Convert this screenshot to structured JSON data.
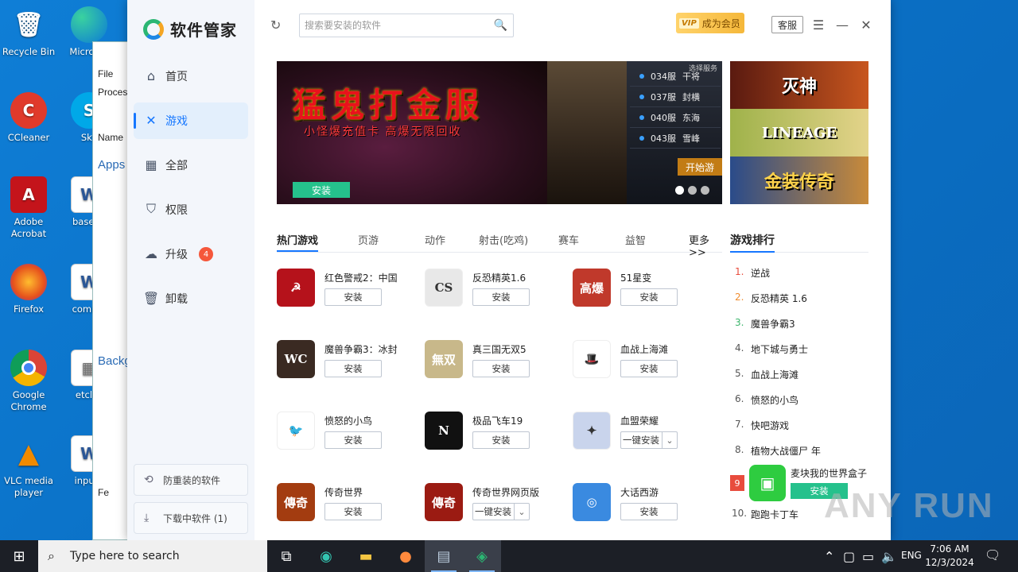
{
  "desktop": {
    "icons_col1": [
      "Recycle Bin",
      "CCleaner",
      "Adobe Acrobat",
      "Firefox",
      "Google Chrome",
      "VLC media player"
    ],
    "icons_col2": [
      "Micro Ed",
      "Sky",
      "basedp",
      "comme",
      "etclos",
      "inputd"
    ]
  },
  "explorer": {
    "menu_file": "File",
    "menu_c": "C",
    "processes": "Process",
    "name_col": "Name",
    "apps": "Apps",
    "backg": "Backg",
    "fe": "Fe"
  },
  "app": {
    "name": "软件管家",
    "search_placeholder": "搜索要安装的软件",
    "vip_badge": "VIP",
    "vip_label": "成为会员",
    "service": "客服",
    "nav": [
      {
        "label": "首页",
        "icon": "home-icon"
      },
      {
        "label": "游戏",
        "icon": "game-icon"
      },
      {
        "label": "全部",
        "icon": "grid-icon"
      },
      {
        "label": "权限",
        "icon": "shield-icon"
      },
      {
        "label": "升级",
        "icon": "upload-cloud-icon",
        "badge": "4"
      },
      {
        "label": "卸载",
        "icon": "trash-icon"
      }
    ],
    "bottom_btns": [
      "防重装的软件",
      "下载中软件  (1)"
    ],
    "banner": {
      "headline": "猛鬼打金服",
      "sub": "小怪爆充值卡  高爆无限回收",
      "servers": [
        [
          "034服",
          "干将"
        ],
        [
          "037服",
          "封横"
        ],
        [
          "040服",
          "东海"
        ],
        [
          "043服",
          "雪峰"
        ]
      ],
      "select_label": "选择服务",
      "start": "开始游",
      "install": "安装"
    },
    "thumbs": [
      "灭神",
      "LINEAGE",
      "金装传奇"
    ],
    "tabs": [
      "热门游戏",
      "页游",
      "动作",
      "射击(吃鸡)",
      "赛车",
      "益智",
      "更多>>"
    ],
    "rank_title": "游戏排行",
    "games": [
      {
        "name": "红色警戒2：中国",
        "btn": "安装",
        "color": "#b5121b",
        "glyph": "☭"
      },
      {
        "name": "反恐精英1.6",
        "btn": "安装",
        "color": "#e8e8e8",
        "glyph": "CS"
      },
      {
        "name": "51星变",
        "btn": "安装",
        "color": "#c0392b",
        "glyph": "高爆"
      },
      {
        "name": "魔兽争霸3：冰封",
        "btn": "安装",
        "color": "#3a2a22",
        "glyph": "WC"
      },
      {
        "name": "真三国无双5",
        "btn": "安装",
        "color": "#c8b88a",
        "glyph": "無双"
      },
      {
        "name": "血战上海滩",
        "btn": "安装",
        "color": "#ffffff",
        "glyph": "🎩"
      },
      {
        "name": "愤怒的小鸟",
        "btn": "安装",
        "color": "#ffffff",
        "glyph": "🐦"
      },
      {
        "name": "极品飞车19",
        "btn": "安装",
        "color": "#111111",
        "glyph": "N"
      },
      {
        "name": "血盟荣耀",
        "btn": "一键安装",
        "color": "#c9d4ec",
        "glyph": "✦",
        "split": true
      },
      {
        "name": "传奇世界",
        "btn": "安装",
        "color": "#a33c10",
        "glyph": "傳奇"
      },
      {
        "name": "传奇世界网页版",
        "btn": "一键安装",
        "color": "#9b1b12",
        "glyph": "傳奇",
        "split": true
      },
      {
        "name": "大话西游",
        "btn": "安装",
        "color": "#3a8ae0",
        "glyph": "◎"
      }
    ],
    "ranking": [
      {
        "n": "1.",
        "name": "逆战"
      },
      {
        "n": "2.",
        "name": "反恐精英 1.6"
      },
      {
        "n": "3.",
        "name": "魔兽争霸3"
      },
      {
        "n": "4.",
        "name": "地下城与勇士"
      },
      {
        "n": "5.",
        "name": "血战上海滩"
      },
      {
        "n": "6.",
        "name": "愤怒的小鸟"
      },
      {
        "n": "7.",
        "name": "快吧游戏"
      },
      {
        "n": "8.",
        "name": "植物大战僵尸 年"
      }
    ],
    "rank9": {
      "n": "9",
      "name": "麦块我的世界盒子",
      "btn": "安装"
    },
    "rank10": {
      "n": "10.",
      "name": "跑跑卡丁车"
    }
  },
  "watermark": "ANY RUN",
  "taskbar": {
    "search": "Type here to search",
    "lang": "ENG",
    "time": "7:06 AM",
    "date": "12/3/2024"
  }
}
